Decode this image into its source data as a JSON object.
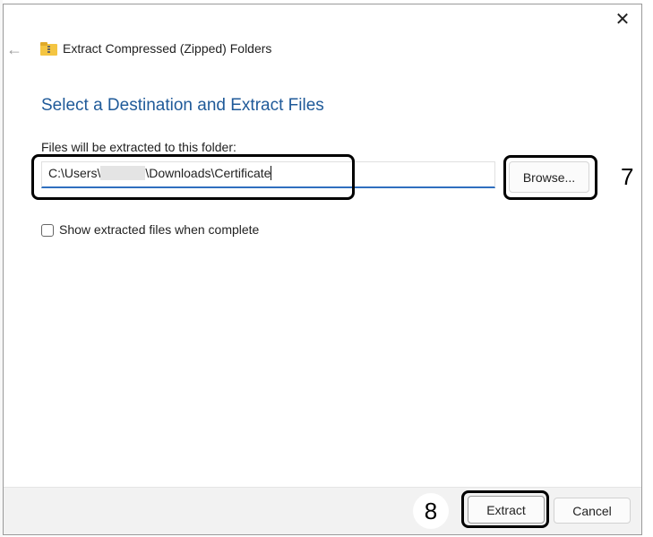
{
  "window": {
    "title": "Extract Compressed (Zipped) Folders",
    "close_glyph": "✕",
    "back_glyph": "←"
  },
  "content": {
    "heading": "Select a Destination and Extract Files",
    "field_label": "Files will be extracted to this folder:",
    "path_prefix": "C:\\Users\\",
    "path_suffix": "\\Downloads\\Certificate",
    "browse_label": "Browse...",
    "checkbox_label": "Show extracted files when complete",
    "checkbox_checked": false
  },
  "footer": {
    "extract_label": "Extract",
    "cancel_label": "Cancel"
  },
  "annotations": {
    "step7": "7",
    "step8": "8"
  },
  "icons": {
    "back": "back-arrow-icon",
    "close": "close-icon",
    "zip": "zip-folder-icon"
  },
  "colors": {
    "heading": "#1f5a99",
    "input_underline": "#2f6fbf",
    "callout": "#000000",
    "footer_bg": "#f2f2f2"
  }
}
